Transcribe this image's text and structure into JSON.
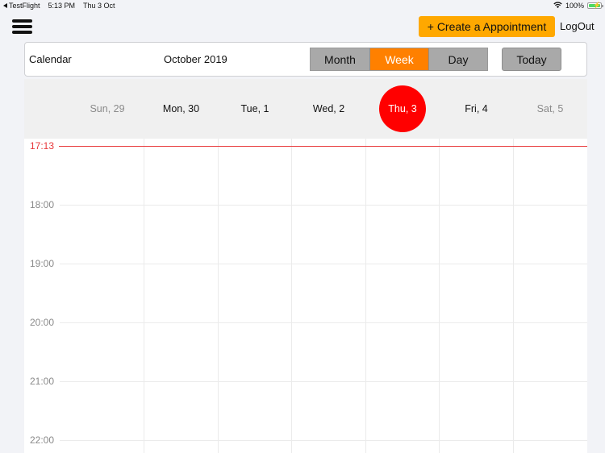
{
  "status_bar": {
    "back_app": "TestFlight",
    "time": "5:13 PM",
    "date": "Thu 3 Oct",
    "battery": "100%",
    "icons": [
      "back-arrow-icon",
      "wifi-icon",
      "battery-charging-icon"
    ]
  },
  "header": {
    "menu_icon": "hamburger-menu-icon",
    "create_button": "+ Create a Appointment",
    "logout": "LogOut",
    "accent_color": "#ffa800"
  },
  "toolbar": {
    "title": "Calendar",
    "month": "October 2019",
    "views": [
      {
        "label": "Month",
        "active": false
      },
      {
        "label": "Week",
        "active": true
      },
      {
        "label": "Day",
        "active": false
      }
    ],
    "today_button": "Today",
    "active_color": "#ff8000"
  },
  "week": {
    "days": [
      {
        "label": "Sun, 29",
        "weekend": true,
        "today": false
      },
      {
        "label": "Mon, 30",
        "weekend": false,
        "today": false
      },
      {
        "label": "Tue, 1",
        "weekend": false,
        "today": false
      },
      {
        "label": "Wed, 2",
        "weekend": false,
        "today": false
      },
      {
        "label": "Thu, 3",
        "weekend": false,
        "today": true
      },
      {
        "label": "Fri, 4",
        "weekend": false,
        "today": false
      },
      {
        "label": "Sat, 5",
        "weekend": true,
        "today": false
      }
    ],
    "today_color": "#ff0000"
  },
  "timeline": {
    "current_time": "17:13",
    "current_time_color": "#e8383b",
    "hours": [
      "18:00",
      "19:00",
      "20:00",
      "21:00",
      "22:00"
    ]
  }
}
